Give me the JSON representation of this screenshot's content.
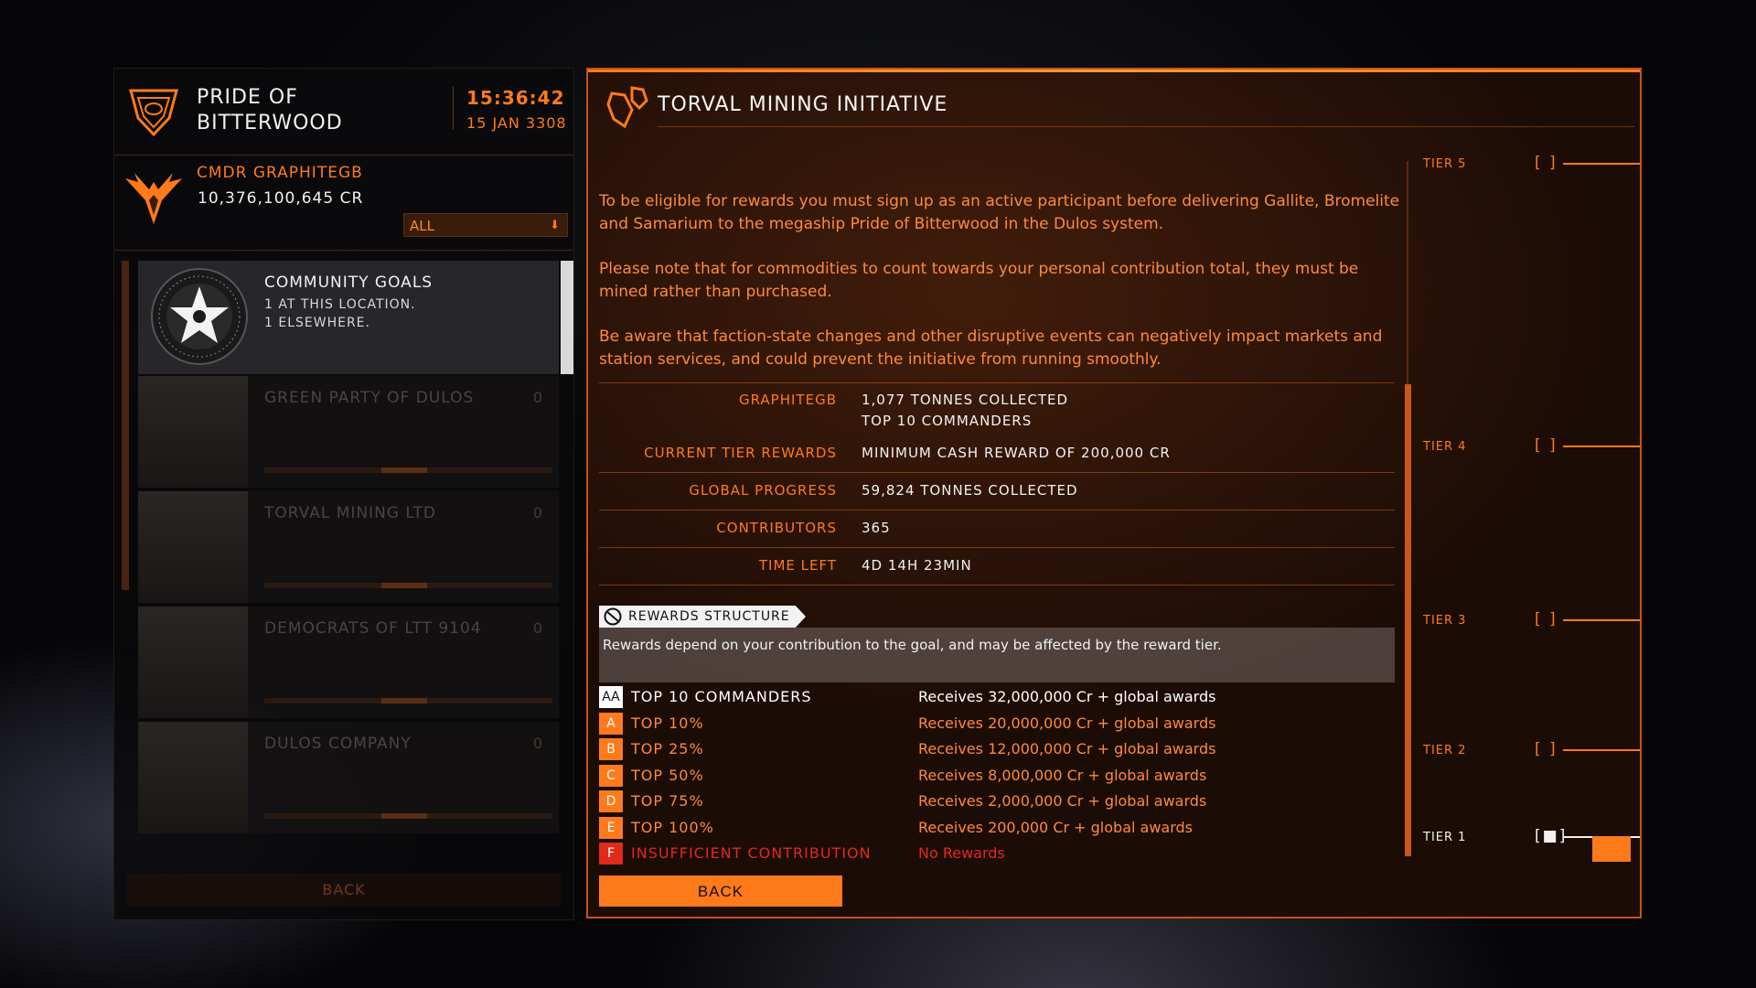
{
  "station": {
    "name": "PRIDE OF BITTERWOOD",
    "time": "15:36:42",
    "date": "15 JAN 3308"
  },
  "commander": {
    "name": "CMDR GRAPHITEGB",
    "credits": "10,376,100,645 CR"
  },
  "filter": {
    "value": "ALL"
  },
  "sidebar": {
    "selected": {
      "title": "COMMUNITY GOALS",
      "line1": "1 AT THIS LOCATION.",
      "line2": "1 ELSEWHERE."
    },
    "items": [
      {
        "label": "GREEN PARTY OF DULOS",
        "count": "0"
      },
      {
        "label": "TORVAL MINING LTD",
        "count": "0"
      },
      {
        "label": "DEMOCRATS OF LTT 9104",
        "count": "0"
      },
      {
        "label": "DULOS COMPANY",
        "count": "0"
      }
    ],
    "back_label": "BACK"
  },
  "goal": {
    "title": "TORVAL MINING INITIATIVE",
    "paragraphs": [
      "To be eligible for rewards you must sign up as an active participant before delivering Gallite, Bromelite and Samarium to the megaship Pride of Bitterwood in the Dulos system.",
      "Please note that for commodities to count towards your personal contribution total, they must be mined rather than purchased.",
      "Be aware that faction-state changes and other disruptive events can negatively impact markets and station services, and could prevent the initiative from running smoothly."
    ],
    "stats": {
      "player_label": "GRAPHITEGB",
      "player_value1": "1,077 TONNES COLLECTED",
      "player_value2": "TOP 10 COMMANDERS",
      "tier_rewards_label": "CURRENT TIER REWARDS",
      "tier_rewards_value": "MINIMUM CASH REWARD OF 200,000 CR",
      "global_label": "GLOBAL PROGRESS",
      "global_value": "59,824 TONNES COLLECTED",
      "contributors_label": "CONTRIBUTORS",
      "contributors_value": "365",
      "time_label": "TIME LEFT",
      "time_value": "4D 14H 23MIN"
    },
    "rewards": {
      "heading": "REWARDS STRUCTURE",
      "description": "Rewards depend on your contribution to the goal, and may be affected by the reward tier.",
      "rows": [
        {
          "badge": "AA",
          "name": "TOP 10 COMMANDERS",
          "desc": "Receives 32,000,000 Cr + global awards"
        },
        {
          "badge": "A",
          "name": "TOP 10%",
          "desc": "Receives 20,000,000 Cr + global awards"
        },
        {
          "badge": "B",
          "name": "TOP 25%",
          "desc": "Receives 12,000,000 Cr + global awards"
        },
        {
          "badge": "C",
          "name": "TOP 50%",
          "desc": "Receives 8,000,000 Cr + global awards"
        },
        {
          "badge": "D",
          "name": "TOP 75%",
          "desc": "Receives 2,000,000 Cr + global awards"
        },
        {
          "badge": "E",
          "name": "TOP 100%",
          "desc": "Receives 200,000 Cr + global awards"
        },
        {
          "badge": "F",
          "name": "INSUFFICIENT CONTRIBUTION",
          "desc": "No Rewards"
        }
      ]
    },
    "back_label": "BACK"
  },
  "tiers": [
    {
      "label": "TIER 5",
      "box": "[ ]"
    },
    {
      "label": "TIER 4",
      "box": "[ ]"
    },
    {
      "label": "TIER 3",
      "box": "[ ]"
    },
    {
      "label": "TIER 2",
      "box": "[ ]"
    },
    {
      "label": "TIER 1",
      "box": "[■]"
    }
  ],
  "colors": {
    "accent": "#ff7a1a",
    "highlight_row": "#ffffff",
    "failure": "#e02a1a"
  }
}
